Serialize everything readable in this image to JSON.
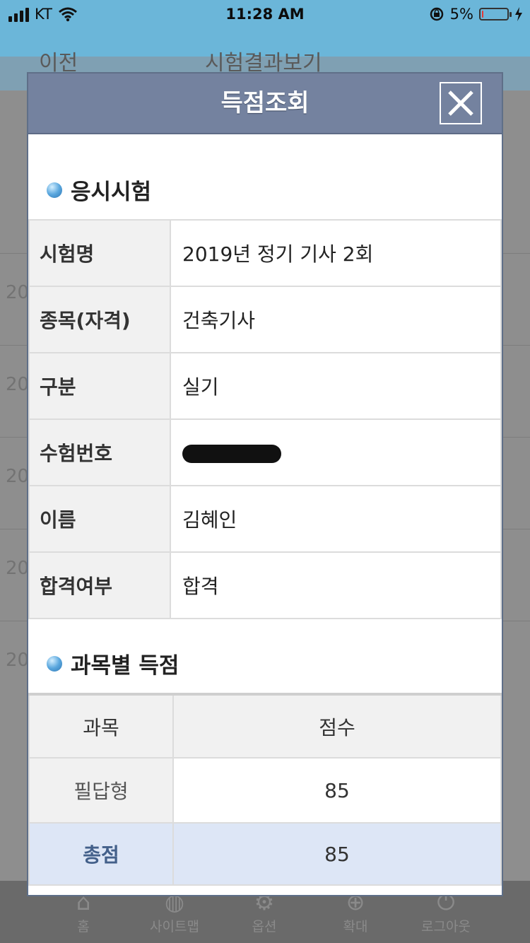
{
  "status_bar": {
    "carrier": "KT",
    "time": "11:28 AM",
    "battery_percent": "5%",
    "battery_level": 0.05,
    "battery_color": "#e53935",
    "icons": [
      "signal-bars-icon",
      "wifi-icon",
      "rotation-lock-icon",
      "battery-icon",
      "charging-bolt-icon"
    ]
  },
  "background_page": {
    "back_label": "이전",
    "title": "시험결과보기",
    "row_year_fragment": "20",
    "tabs": [
      {
        "label": "홈",
        "icon": "home-icon"
      },
      {
        "label": "사이트맵",
        "icon": "globe-icon"
      },
      {
        "label": "옵션",
        "icon": "gear-icon"
      },
      {
        "label": "확대",
        "icon": "plus-circle-icon"
      },
      {
        "label": "로그아웃",
        "icon": "power-icon"
      }
    ]
  },
  "modal": {
    "title": "득점조회",
    "close_icon": "close-icon",
    "exam_section": {
      "title": "응시시험",
      "rows": [
        {
          "label": "시험명",
          "value": "2019년 정기 기사 2회"
        },
        {
          "label": "종목(자격)",
          "value": "건축기사"
        },
        {
          "label": "구분",
          "value": "실기"
        },
        {
          "label": "수험번호",
          "value": ""
        },
        {
          "label": "이름",
          "value": "김혜인"
        },
        {
          "label": "합격여부",
          "value": "합격"
        }
      ]
    },
    "score_section": {
      "title": "과목별 득점",
      "headers": {
        "subject": "과목",
        "score": "점수"
      },
      "rows": [
        {
          "subject": "필답형",
          "score": "85"
        }
      ],
      "total": {
        "label": "총점",
        "score": "85"
      }
    }
  }
}
